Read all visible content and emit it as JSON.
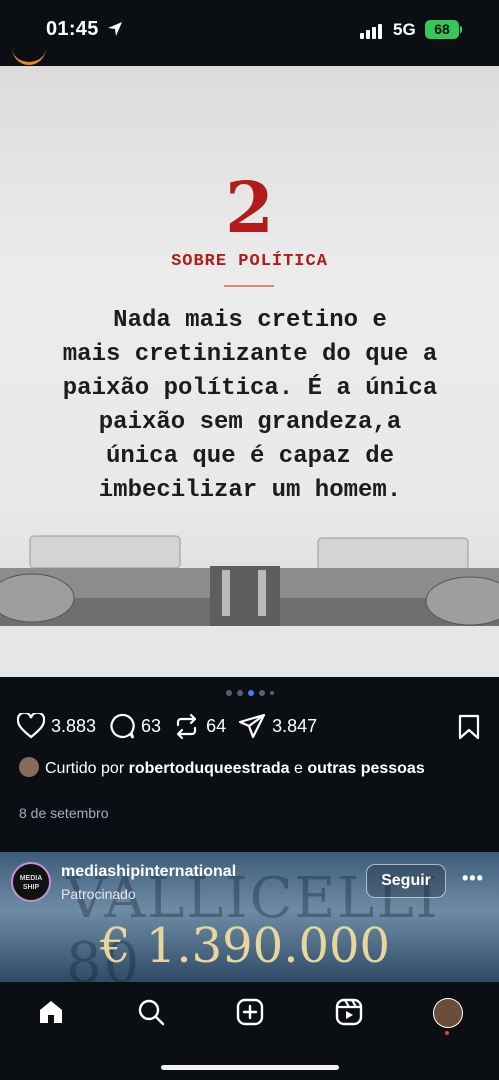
{
  "status_bar": {
    "time": "01:45",
    "network": "5G",
    "battery": "68"
  },
  "post": {
    "number": "2",
    "topic": "SOBRE POLÍTICA",
    "quote_lines": [
      "Nada mais cretino e",
      "mais cretinizante do que a",
      "paixão política. É a única",
      "paixão sem grandeza,a",
      "única que é capaz de",
      "imbecilizar um homem."
    ],
    "carousel": {
      "count": 5,
      "active_index": 2
    },
    "stats": {
      "likes": "3.883",
      "comments": "63",
      "reposts": "64",
      "shares": "3.847"
    },
    "liked_by": {
      "prefix": "Curtido por",
      "user": "robertoduqueestrada",
      "connector": "e",
      "others": "outras pessoas"
    },
    "date": "8 de setembro"
  },
  "ad": {
    "logo_text": "MEDIA SHIP",
    "account": "mediashipinternational",
    "sponsored": "Patrocinado",
    "follow_label": "Seguir",
    "more_label": "•••",
    "watermark": "VALLICELLI 80",
    "price": "€ 1.390.000"
  },
  "nav": {
    "items": [
      "home-icon",
      "search-icon",
      "create-icon",
      "reels-icon",
      "profile-avatar"
    ]
  },
  "colors": {
    "accent_red": "#b31b1b",
    "active_dot": "#3b82f6",
    "battery": "#34c759",
    "background": "#0b0f14"
  }
}
